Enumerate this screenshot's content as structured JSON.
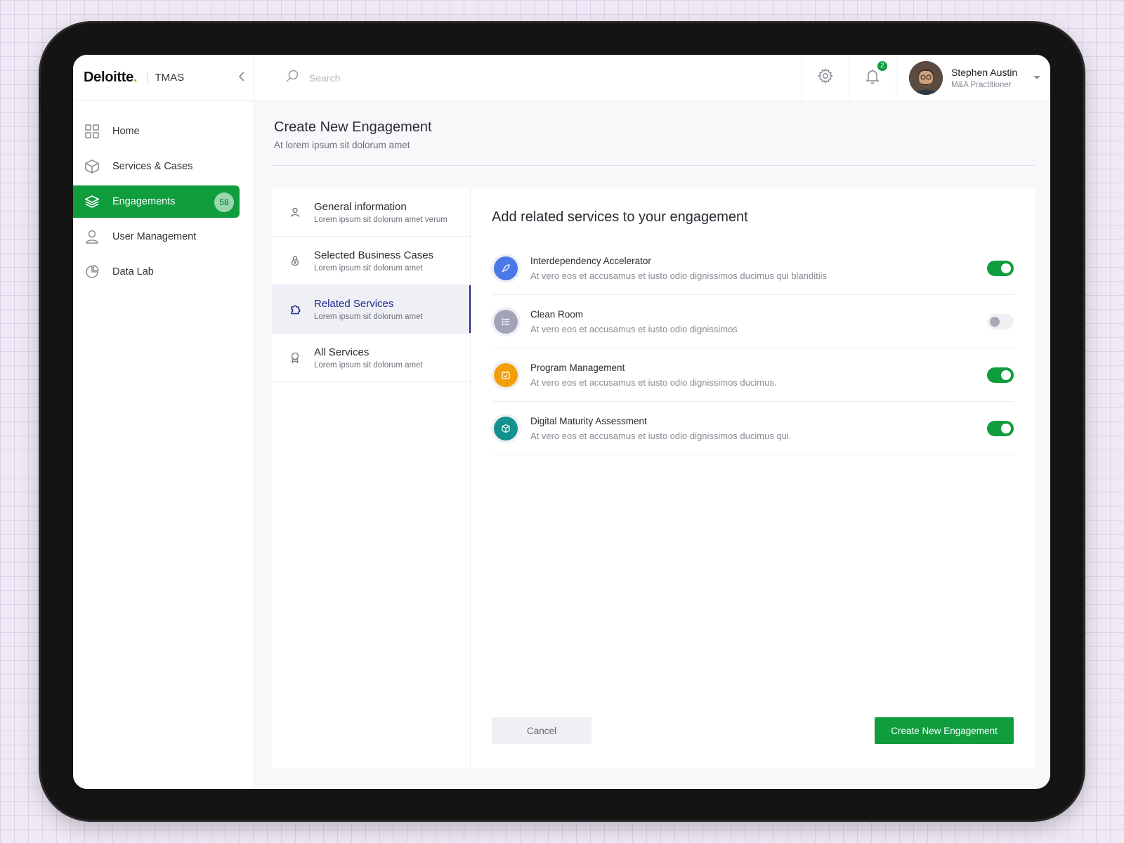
{
  "brand": {
    "logo": "Deloitte",
    "logo_dot": ".",
    "app": "TMAS"
  },
  "sidebar": {
    "items": [
      {
        "label": "Home",
        "icon": "grid-icon"
      },
      {
        "label": "Services & Cases",
        "icon": "cube-icon"
      },
      {
        "label": "Engagements",
        "icon": "layers-icon",
        "badge": "58",
        "active": true
      },
      {
        "label": "User Management",
        "icon": "user-icon"
      },
      {
        "label": "Data Lab",
        "icon": "pie-chart-icon"
      }
    ]
  },
  "topbar": {
    "search_placeholder": "Search",
    "notification_count": "2",
    "user": {
      "name": "Stephen Austin",
      "role": "M&A Practitioner"
    }
  },
  "page": {
    "title": "Create New Engagement",
    "subtitle": "At lorem ipsum sit dolorum amet"
  },
  "steps": [
    {
      "title": "General information",
      "subtitle": "Lorem ipsum sit dolorum amet verum",
      "icon": "user-icon"
    },
    {
      "title": "Selected Business Cases",
      "subtitle": "Lorem ipsum sit dolorum amet",
      "icon": "lock-icon"
    },
    {
      "title": "Related Services",
      "subtitle": "Lorem ipsum sit dolorum amet",
      "icon": "puzzle-icon",
      "active": true
    },
    {
      "title": "All Services",
      "subtitle": "Lorem ipsum sit dolorum amet",
      "icon": "award-icon"
    }
  ],
  "content": {
    "title": "Add related services to your engagement",
    "services": [
      {
        "title": "Interdependency Accelerator",
        "desc": "At vero eos et accusamus et iusto odio dignissimos ducimus qui blanditiis",
        "icon": "rocket-icon",
        "color": "#4a78e6",
        "enabled": true
      },
      {
        "title": "Clean Room",
        "desc": "At vero eos et accusamus et iusto odio dignissimos",
        "icon": "list-icon",
        "color": "#a3a3b8",
        "enabled": false
      },
      {
        "title": "Program Management",
        "desc": "At vero eos et accusamus et iusto odio dignissimos ducimus.",
        "icon": "calendar-icon",
        "color": "#f59e0b",
        "enabled": true
      },
      {
        "title": "Digital Maturity Assessment",
        "desc": "At vero eos et accusamus et iusto odio dignissimos ducimus qui.",
        "icon": "box-icon",
        "color": "#14918f",
        "enabled": true
      }
    ],
    "cancel_label": "Cancel",
    "create_label": "Create New Engagement"
  },
  "colors": {
    "accent": "#0f9d3e",
    "active_step": "#1f2a8a"
  }
}
